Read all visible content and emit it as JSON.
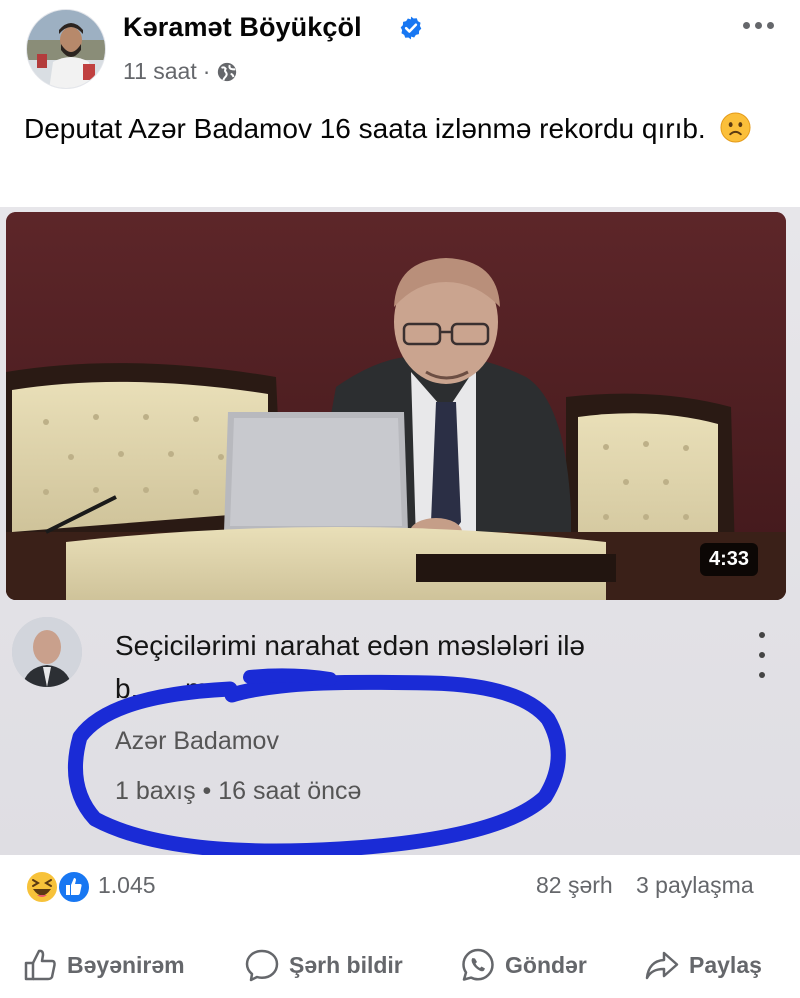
{
  "post": {
    "author_name": "Kəramət Böyükçöl",
    "time": "11 saat",
    "time_separator": "·",
    "text": "Deputat Azər Badamov 16 saata izlənmə rekordu qırıb."
  },
  "shared_photo": {
    "video_duration": "4:33",
    "video_title_line1": "Seçicilərimi narahat edən məslələri ilə",
    "video_title_line2": "b... ...m",
    "channel_name": "Azər Badamov",
    "video_meta": "1 baxış • 16 saat öncə"
  },
  "stats": {
    "reactions_count": "1.045",
    "comments": "82 şərh",
    "shares": "3 paylaşma"
  },
  "actions": {
    "like": "Bəyənirəm",
    "comment": "Şərh bildir",
    "send": "Göndər",
    "share": "Paylaş"
  },
  "colors": {
    "secondary_text": "#65676b",
    "verified_blue": "#1877f2",
    "scribble_blue": "#1a2bd6"
  },
  "icons": [
    "verified-badge-icon",
    "globe-icon",
    "more-icon",
    "sad-emoji-icon",
    "haha-reaction-icon",
    "like-reaction-icon",
    "like-icon",
    "comment-icon",
    "whatsapp-icon",
    "share-icon"
  ]
}
